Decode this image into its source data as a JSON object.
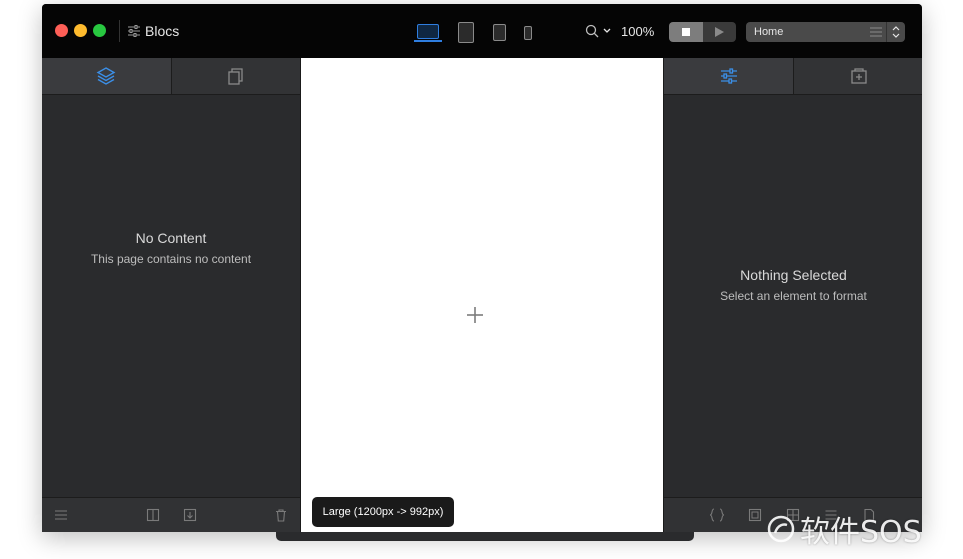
{
  "window": {
    "title": "Blocs",
    "zoom": "100%",
    "page_selector": "Home"
  },
  "left_panel": {
    "empty_title": "No Content",
    "empty_subtitle": "This page contains no content"
  },
  "right_panel": {
    "empty_title": "Nothing Selected",
    "empty_subtitle": "Select an element to format"
  },
  "canvas": {
    "breakpoint_tooltip": "Large (1200px -> 992px)"
  },
  "watermark": {
    "text": "软件SOS"
  },
  "colors": {
    "accent": "#2f7ee0",
    "panel_bg": "#2a2b2d",
    "titlebar_bg": "#050505"
  }
}
